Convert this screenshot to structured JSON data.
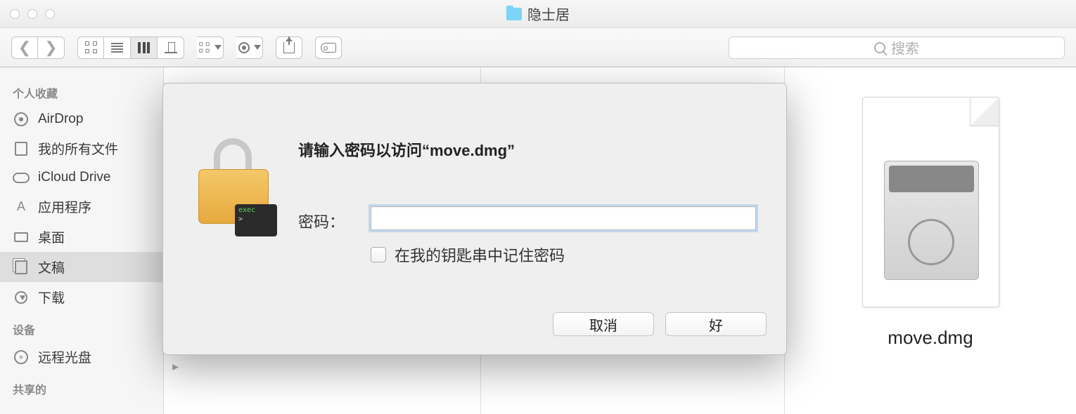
{
  "window": {
    "title": "隐士居"
  },
  "toolbar": {
    "search_placeholder": "搜索"
  },
  "sidebar": {
    "favorites_header": "个人收藏",
    "devices_header": "设备",
    "shared_header": "共享的",
    "items": [
      {
        "label": "AirDrop"
      },
      {
        "label": "我的所有文件"
      },
      {
        "label": "iCloud Drive"
      },
      {
        "label": "应用程序"
      },
      {
        "label": "桌面"
      },
      {
        "label": "文稿"
      },
      {
        "label": "下载"
      }
    ],
    "devices": [
      {
        "label": "远程光盘"
      }
    ]
  },
  "preview": {
    "filename": "move.dmg"
  },
  "dialog": {
    "title": "请输入密码以访问“move.dmg”",
    "password_label": "密码：",
    "remember_label": "在我的钥匙串中记住密码",
    "cancel": "取消",
    "ok": "好"
  }
}
